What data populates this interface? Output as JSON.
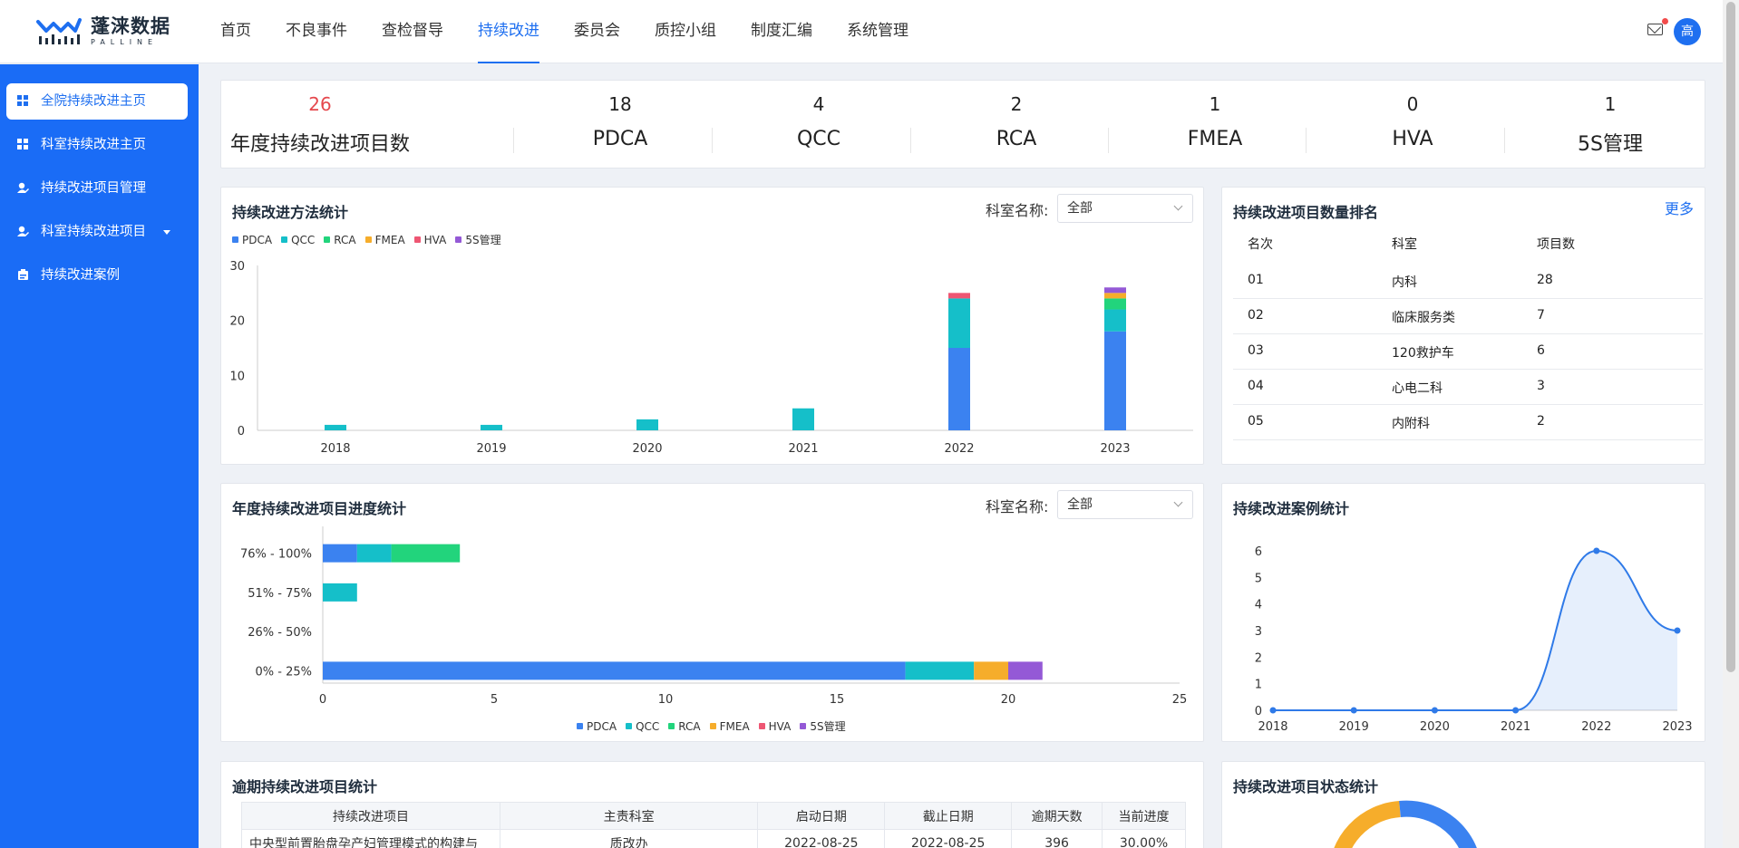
{
  "brand": {
    "name": "蓬涞数据",
    "sub": "PALLINE"
  },
  "nav": [
    {
      "label": "首页"
    },
    {
      "label": "不良事件"
    },
    {
      "label": "查检督导"
    },
    {
      "label": "持续改进",
      "active": true
    },
    {
      "label": "委员会"
    },
    {
      "label": "质控小组"
    },
    {
      "label": "制度汇编"
    },
    {
      "label": "系统管理"
    }
  ],
  "user": {
    "avatar": "高",
    "mail_icon": "mail-icon",
    "unread": true
  },
  "sidebar": [
    {
      "label": "全院持续改进主页",
      "icon": "grid-icon",
      "active": true
    },
    {
      "label": "科室持续改进主页",
      "icon": "grid-icon"
    },
    {
      "label": "持续改进项目管理",
      "icon": "user-edit-icon"
    },
    {
      "label": "科室持续改进项目",
      "icon": "user-edit-icon",
      "expandable": true
    },
    {
      "label": "持续改进案例",
      "icon": "case-icon"
    }
  ],
  "summary": [
    {
      "value": "26",
      "label": "年度持续改进项目数",
      "highlight": true
    },
    {
      "value": "18",
      "label": "PDCA"
    },
    {
      "value": "4",
      "label": "QCC"
    },
    {
      "value": "2",
      "label": "RCA"
    },
    {
      "value": "1",
      "label": "FMEA"
    },
    {
      "value": "0",
      "label": "HVA"
    },
    {
      "value": "1",
      "label": "5S管理"
    }
  ],
  "colors": {
    "PDCA": "#3b82f0",
    "QCC": "#15bfc9",
    "RCA": "#22d47c",
    "FMEA": "#f6ad2b",
    "HVA": "#ee5673",
    "5S管理": "#9459d6",
    "line": "#2f7ae8"
  },
  "method_card": {
    "title": "持续改进方法统计",
    "filter_label": "科室名称:",
    "filter_value": "全部"
  },
  "progress_card": {
    "title": "年度持续改进项目进度统计",
    "filter_label": "科室名称:",
    "filter_value": "全部"
  },
  "rank_card": {
    "title": "持续改进项目数量排名",
    "more": "更多",
    "headers": [
      "名次",
      "科室",
      "项目数"
    ],
    "rows": [
      [
        "01",
        "内科",
        "28"
      ],
      [
        "02",
        "临床服务类",
        "7"
      ],
      [
        "03",
        "120救护车",
        "6"
      ],
      [
        "04",
        "心电二科",
        "3"
      ],
      [
        "05",
        "内附科",
        "2"
      ]
    ]
  },
  "case_card": {
    "title": "持续改进案例统计"
  },
  "overdue_card": {
    "title": "逾期持续改进项目统计",
    "headers": [
      "持续改进项目",
      "主责科室",
      "启动日期",
      "截止日期",
      "逾期天数",
      "当前进度"
    ],
    "rows": [
      [
        "中央型前置胎盘孕产妇管理模式的构建与",
        "质改办",
        "2022-08-25",
        "2022-08-25",
        "396",
        "30.00%"
      ]
    ]
  },
  "status_card": {
    "title": "持续改进项目状态统计"
  },
  "chart_data": [
    {
      "type": "bar",
      "stacked": true,
      "title": "持续改进方法统计",
      "categories": [
        "2018",
        "2019",
        "2020",
        "2021",
        "2022",
        "2023"
      ],
      "series": [
        {
          "name": "PDCA",
          "values": [
            0,
            0,
            0,
            0,
            15,
            18
          ]
        },
        {
          "name": "QCC",
          "values": [
            1,
            1,
            2,
            4,
            9,
            4
          ]
        },
        {
          "name": "RCA",
          "values": [
            0,
            0,
            0,
            0,
            0,
            2
          ]
        },
        {
          "name": "FMEA",
          "values": [
            0,
            0,
            0,
            0,
            0,
            1
          ]
        },
        {
          "name": "HVA",
          "values": [
            0,
            0,
            0,
            0,
            1,
            0
          ]
        },
        {
          "name": "5S管理",
          "values": [
            0,
            0,
            0,
            0,
            0,
            1
          ]
        }
      ],
      "ylim": [
        0,
        30
      ],
      "yticks": [
        0,
        10,
        20,
        30
      ],
      "legend": "top-left"
    },
    {
      "type": "bar",
      "orientation": "horizontal",
      "stacked": true,
      "title": "年度持续改进项目进度统计",
      "categories": [
        "76% - 100%",
        "51% - 75%",
        "26% - 50%",
        "0% - 25%"
      ],
      "series": [
        {
          "name": "PDCA",
          "values": [
            1,
            0,
            0,
            17
          ]
        },
        {
          "name": "QCC",
          "values": [
            1,
            1,
            0,
            2
          ]
        },
        {
          "name": "RCA",
          "values": [
            2,
            0,
            0,
            0
          ]
        },
        {
          "name": "FMEA",
          "values": [
            0,
            0,
            0,
            1
          ]
        },
        {
          "name": "HVA",
          "values": [
            0,
            0,
            0,
            0
          ]
        },
        {
          "name": "5S管理",
          "values": [
            0,
            0,
            0,
            1
          ]
        }
      ],
      "xlim": [
        0,
        25
      ],
      "xticks": [
        0,
        5,
        10,
        15,
        20,
        25
      ],
      "legend": "bottom"
    },
    {
      "type": "area",
      "smooth": true,
      "title": "持续改进案例统计",
      "x": [
        "2018",
        "2019",
        "2020",
        "2021",
        "2022",
        "2023"
      ],
      "values": [
        0,
        0,
        0,
        0,
        6,
        3
      ],
      "ylim": [
        0,
        6
      ],
      "yticks": [
        0,
        1,
        2,
        3,
        4,
        5,
        6
      ]
    }
  ]
}
